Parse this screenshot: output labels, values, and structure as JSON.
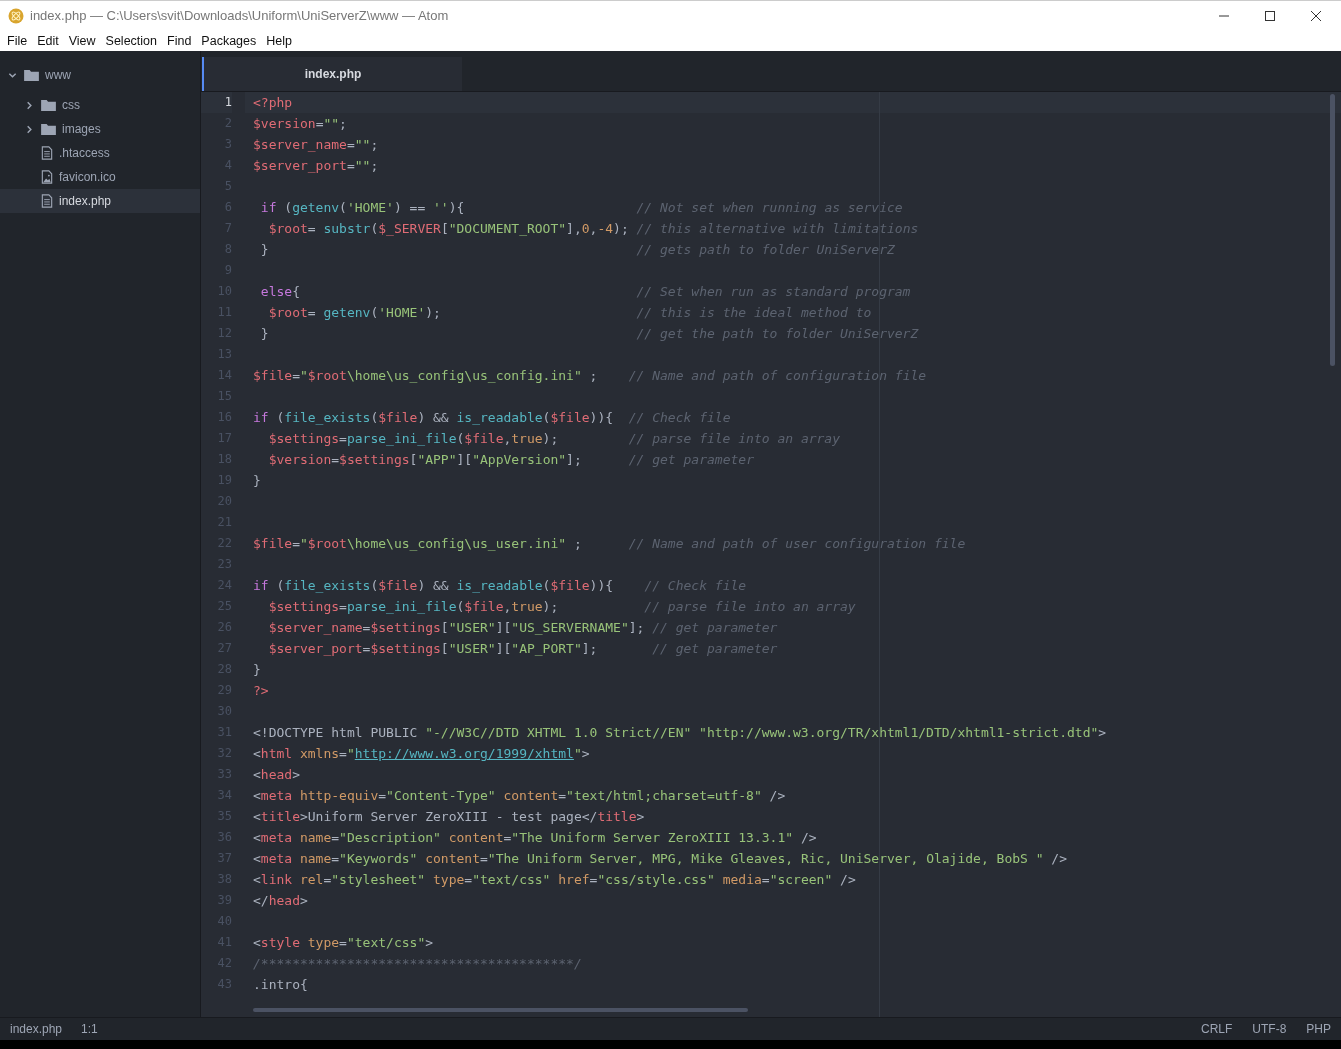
{
  "window": {
    "title": "index.php — C:\\Users\\svit\\Downloads\\Uniform\\UniServerZ\\www — Atom"
  },
  "menu": [
    "File",
    "Edit",
    "View",
    "Selection",
    "Find",
    "Packages",
    "Help"
  ],
  "tree": [
    {
      "label": "www",
      "kind": "folder",
      "expanded": true,
      "selected": false,
      "children": [
        {
          "label": "css",
          "kind": "folder",
          "expanded": false,
          "selected": false
        },
        {
          "label": "images",
          "kind": "folder",
          "expanded": false,
          "selected": false
        },
        {
          "label": ".htaccess",
          "kind": "file",
          "selected": false
        },
        {
          "label": "favicon.ico",
          "kind": "image",
          "selected": false
        },
        {
          "label": "index.php",
          "kind": "file",
          "selected": true
        }
      ]
    }
  ],
  "tabs": [
    {
      "label": "index.php",
      "selected": true
    }
  ],
  "lines": [
    {
      "number": "1",
      "current": true,
      "tokens": [
        {
          "kind": "tag",
          "text": "<?php"
        }
      ]
    },
    {
      "number": "2",
      "current": false,
      "tokens": [
        {
          "kind": "var",
          "text": "$version"
        },
        {
          "kind": "plain",
          "text": "="
        },
        {
          "kind": "str",
          "text": "\"\""
        },
        {
          "kind": "plain",
          "text": ";"
        }
      ]
    },
    {
      "number": "3",
      "current": false,
      "tokens": [
        {
          "kind": "var",
          "text": "$server_name"
        },
        {
          "kind": "plain",
          "text": "="
        },
        {
          "kind": "str",
          "text": "\"\""
        },
        {
          "kind": "plain",
          "text": ";"
        }
      ]
    },
    {
      "number": "4",
      "current": false,
      "tokens": [
        {
          "kind": "var",
          "text": "$server_port"
        },
        {
          "kind": "plain",
          "text": "="
        },
        {
          "kind": "str",
          "text": "\"\""
        },
        {
          "kind": "plain",
          "text": ";"
        }
      ]
    },
    {
      "number": "5",
      "current": false
    },
    {
      "number": "6",
      "current": false,
      "tokens": [
        {
          "kind": "kw",
          "text": " if"
        },
        {
          "kind": "plain",
          "text": " ("
        },
        {
          "kind": "fn",
          "text": "getenv"
        },
        {
          "kind": "plain",
          "text": "("
        },
        {
          "kind": "str",
          "text": "'HOME'"
        },
        {
          "kind": "plain",
          "text": ") == "
        },
        {
          "kind": "str",
          "text": "''"
        },
        {
          "kind": "plain",
          "text": "){                      "
        },
        {
          "kind": "cmt",
          "text": "// Not set when running as service"
        }
      ]
    },
    {
      "number": "7",
      "current": false,
      "tokens": [
        {
          "kind": "var",
          "text": "  $root"
        },
        {
          "kind": "plain",
          "text": "= "
        },
        {
          "kind": "fn",
          "text": "substr"
        },
        {
          "kind": "plain",
          "text": "("
        },
        {
          "kind": "var",
          "text": "$_SERVER"
        },
        {
          "kind": "plain",
          "text": "["
        },
        {
          "kind": "str",
          "text": "\"DOCUMENT_ROOT\""
        },
        {
          "kind": "plain",
          "text": "],"
        },
        {
          "kind": "num",
          "text": "0"
        },
        {
          "kind": "plain",
          "text": ","
        },
        {
          "kind": "num",
          "text": "-4"
        },
        {
          "kind": "plain",
          "text": "); "
        },
        {
          "kind": "cmt",
          "text": "// this alternative with limitations"
        }
      ]
    },
    {
      "number": "8",
      "current": false,
      "tokens": [
        {
          "kind": "plain",
          "text": " }                                               "
        },
        {
          "kind": "cmt",
          "text": "// gets path to folder UniServerZ"
        }
      ]
    },
    {
      "number": "9",
      "current": false
    },
    {
      "number": "10",
      "current": false,
      "tokens": [
        {
          "kind": "kw",
          "text": " else"
        },
        {
          "kind": "plain",
          "text": "{                                           "
        },
        {
          "kind": "cmt",
          "text": "// Set when run as standard program"
        }
      ]
    },
    {
      "number": "11",
      "current": false,
      "tokens": [
        {
          "kind": "var",
          "text": "  $root"
        },
        {
          "kind": "plain",
          "text": "= "
        },
        {
          "kind": "fn",
          "text": "getenv"
        },
        {
          "kind": "plain",
          "text": "("
        },
        {
          "kind": "str",
          "text": "'HOME'"
        },
        {
          "kind": "plain",
          "text": ");                         "
        },
        {
          "kind": "cmt",
          "text": "// this is the ideal method to"
        }
      ]
    },
    {
      "number": "12",
      "current": false,
      "tokens": [
        {
          "kind": "plain",
          "text": " }                                               "
        },
        {
          "kind": "cmt",
          "text": "// get the path to folder UniServerZ"
        }
      ]
    },
    {
      "number": "13",
      "current": false
    },
    {
      "number": "14",
      "current": false,
      "tokens": [
        {
          "kind": "var",
          "text": "$file"
        },
        {
          "kind": "plain",
          "text": "="
        },
        {
          "kind": "str",
          "text": "\""
        },
        {
          "kind": "var",
          "text": "$root"
        },
        {
          "kind": "str",
          "text": "\\home\\us_config\\us_config.ini\""
        },
        {
          "kind": "plain",
          "text": " ;    "
        },
        {
          "kind": "cmt",
          "text": "// Name and path of configuration file"
        }
      ]
    },
    {
      "number": "15",
      "current": false
    },
    {
      "number": "16",
      "current": false,
      "tokens": [
        {
          "kind": "kw",
          "text": "if"
        },
        {
          "kind": "plain",
          "text": " ("
        },
        {
          "kind": "fn",
          "text": "file_exists"
        },
        {
          "kind": "plain",
          "text": "("
        },
        {
          "kind": "var",
          "text": "$file"
        },
        {
          "kind": "plain",
          "text": ") && "
        },
        {
          "kind": "fn",
          "text": "is_readable"
        },
        {
          "kind": "plain",
          "text": "("
        },
        {
          "kind": "var",
          "text": "$file"
        },
        {
          "kind": "plain",
          "text": ")){  "
        },
        {
          "kind": "cmt",
          "text": "// Check file"
        }
      ]
    },
    {
      "number": "17",
      "current": false,
      "tokens": [
        {
          "kind": "var",
          "text": "  $settings"
        },
        {
          "kind": "plain",
          "text": "="
        },
        {
          "kind": "fn",
          "text": "parse_ini_file"
        },
        {
          "kind": "plain",
          "text": "("
        },
        {
          "kind": "var",
          "text": "$file"
        },
        {
          "kind": "plain",
          "text": ","
        },
        {
          "kind": "num",
          "text": "true"
        },
        {
          "kind": "plain",
          "text": ");         "
        },
        {
          "kind": "cmt",
          "text": "// parse file into an array"
        }
      ]
    },
    {
      "number": "18",
      "current": false,
      "tokens": [
        {
          "kind": "var",
          "text": "  $version"
        },
        {
          "kind": "plain",
          "text": "="
        },
        {
          "kind": "var",
          "text": "$settings"
        },
        {
          "kind": "plain",
          "text": "["
        },
        {
          "kind": "str",
          "text": "\"APP\""
        },
        {
          "kind": "plain",
          "text": "]["
        },
        {
          "kind": "str",
          "text": "\"AppVersion\""
        },
        {
          "kind": "plain",
          "text": "];      "
        },
        {
          "kind": "cmt",
          "text": "// get parameter"
        }
      ]
    },
    {
      "number": "19",
      "current": false,
      "tokens": [
        {
          "kind": "plain",
          "text": "}"
        }
      ]
    },
    {
      "number": "20",
      "current": false
    },
    {
      "number": "21",
      "current": false
    },
    {
      "number": "22",
      "current": false,
      "tokens": [
        {
          "kind": "var",
          "text": "$file"
        },
        {
          "kind": "plain",
          "text": "="
        },
        {
          "kind": "str",
          "text": "\""
        },
        {
          "kind": "var",
          "text": "$root"
        },
        {
          "kind": "str",
          "text": "\\home\\us_config\\us_user.ini\""
        },
        {
          "kind": "plain",
          "text": " ;      "
        },
        {
          "kind": "cmt",
          "text": "// Name and path of user configuration file"
        }
      ]
    },
    {
      "number": "23",
      "current": false
    },
    {
      "number": "24",
      "current": false,
      "tokens": [
        {
          "kind": "kw",
          "text": "if"
        },
        {
          "kind": "plain",
          "text": " ("
        },
        {
          "kind": "fn",
          "text": "file_exists"
        },
        {
          "kind": "plain",
          "text": "("
        },
        {
          "kind": "var",
          "text": "$file"
        },
        {
          "kind": "plain",
          "text": ") && "
        },
        {
          "kind": "fn",
          "text": "is_readable"
        },
        {
          "kind": "plain",
          "text": "("
        },
        {
          "kind": "var",
          "text": "$file"
        },
        {
          "kind": "plain",
          "text": ")){    "
        },
        {
          "kind": "cmt",
          "text": "// Check file"
        }
      ]
    },
    {
      "number": "25",
      "current": false,
      "tokens": [
        {
          "kind": "var",
          "text": "  $settings"
        },
        {
          "kind": "plain",
          "text": "="
        },
        {
          "kind": "fn",
          "text": "parse_ini_file"
        },
        {
          "kind": "plain",
          "text": "("
        },
        {
          "kind": "var",
          "text": "$file"
        },
        {
          "kind": "plain",
          "text": ","
        },
        {
          "kind": "num",
          "text": "true"
        },
        {
          "kind": "plain",
          "text": ");           "
        },
        {
          "kind": "cmt",
          "text": "// parse file into an array"
        }
      ]
    },
    {
      "number": "26",
      "current": false,
      "tokens": [
        {
          "kind": "var",
          "text": "  $server_name"
        },
        {
          "kind": "plain",
          "text": "="
        },
        {
          "kind": "var",
          "text": "$settings"
        },
        {
          "kind": "plain",
          "text": "["
        },
        {
          "kind": "str",
          "text": "\"USER\""
        },
        {
          "kind": "plain",
          "text": "]["
        },
        {
          "kind": "str",
          "text": "\"US_SERVERNAME\""
        },
        {
          "kind": "plain",
          "text": "]; "
        },
        {
          "kind": "cmt",
          "text": "// get parameter"
        }
      ]
    },
    {
      "number": "27",
      "current": false,
      "tokens": [
        {
          "kind": "var",
          "text": "  $server_port"
        },
        {
          "kind": "plain",
          "text": "="
        },
        {
          "kind": "var",
          "text": "$settings"
        },
        {
          "kind": "plain",
          "text": "["
        },
        {
          "kind": "str",
          "text": "\"USER\""
        },
        {
          "kind": "plain",
          "text": "]["
        },
        {
          "kind": "str",
          "text": "\"AP_PORT\""
        },
        {
          "kind": "plain",
          "text": "];       "
        },
        {
          "kind": "cmt",
          "text": "// get parameter"
        }
      ]
    },
    {
      "number": "28",
      "current": false,
      "tokens": [
        {
          "kind": "plain",
          "text": "}"
        }
      ]
    },
    {
      "number": "29",
      "current": false,
      "tokens": [
        {
          "kind": "tag",
          "text": "?>"
        }
      ]
    },
    {
      "number": "30",
      "current": false
    },
    {
      "number": "31",
      "current": false,
      "tokens": [
        {
          "kind": "plain",
          "text": "<!DOCTYPE html PUBLIC "
        },
        {
          "kind": "str",
          "text": "\"-//W3C//DTD XHTML 1.0 Strict//EN\" \"http://www.w3.org/TR/xhtml1/DTD/xhtml1-strict.dtd\""
        },
        {
          "kind": "plain",
          "text": ">"
        }
      ]
    },
    {
      "number": "32",
      "current": false,
      "tokens": [
        {
          "kind": "plain",
          "text": "<"
        },
        {
          "kind": "tag",
          "text": "html"
        },
        {
          "kind": "attr",
          "text": " xmlns"
        },
        {
          "kind": "plain",
          "text": "="
        },
        {
          "kind": "str",
          "text": "\""
        },
        {
          "kind": "link",
          "text": "http://www.w3.org/1999/xhtml"
        },
        {
          "kind": "str",
          "text": "\""
        },
        {
          "kind": "plain",
          "text": ">"
        }
      ]
    },
    {
      "number": "33",
      "current": false,
      "tokens": [
        {
          "kind": "plain",
          "text": "<"
        },
        {
          "kind": "tag",
          "text": "head"
        },
        {
          "kind": "plain",
          "text": ">"
        }
      ]
    },
    {
      "number": "34",
      "current": false,
      "tokens": [
        {
          "kind": "plain",
          "text": "<"
        },
        {
          "kind": "tag",
          "text": "meta"
        },
        {
          "kind": "attr",
          "text": " http-equiv"
        },
        {
          "kind": "plain",
          "text": "="
        },
        {
          "kind": "str",
          "text": "\"Content-Type\""
        },
        {
          "kind": "attr",
          "text": " content"
        },
        {
          "kind": "plain",
          "text": "="
        },
        {
          "kind": "str",
          "text": "\"text/html;charset=utf-8\""
        },
        {
          "kind": "plain",
          "text": " />"
        }
      ]
    },
    {
      "number": "35",
      "current": false,
      "tokens": [
        {
          "kind": "plain",
          "text": "<"
        },
        {
          "kind": "tag",
          "text": "title"
        },
        {
          "kind": "plain",
          "text": ">Uniform Server ZeroXIII - test page</"
        },
        {
          "kind": "tag",
          "text": "title"
        },
        {
          "kind": "plain",
          "text": ">"
        }
      ]
    },
    {
      "number": "36",
      "current": false,
      "tokens": [
        {
          "kind": "plain",
          "text": "<"
        },
        {
          "kind": "tag",
          "text": "meta"
        },
        {
          "kind": "attr",
          "text": " name"
        },
        {
          "kind": "plain",
          "text": "="
        },
        {
          "kind": "str",
          "text": "\"Description\""
        },
        {
          "kind": "attr",
          "text": " content"
        },
        {
          "kind": "plain",
          "text": "="
        },
        {
          "kind": "str",
          "text": "\"The Uniform Server ZeroXIII 13.3.1\""
        },
        {
          "kind": "plain",
          "text": " />"
        }
      ]
    },
    {
      "number": "37",
      "current": false,
      "tokens": [
        {
          "kind": "plain",
          "text": "<"
        },
        {
          "kind": "tag",
          "text": "meta"
        },
        {
          "kind": "attr",
          "text": " name"
        },
        {
          "kind": "plain",
          "text": "="
        },
        {
          "kind": "str",
          "text": "\"Keywords\""
        },
        {
          "kind": "attr",
          "text": " content"
        },
        {
          "kind": "plain",
          "text": "="
        },
        {
          "kind": "str",
          "text": "\"The Uniform Server, MPG, Mike Gleaves, Ric, UniServer, Olajide, BobS \""
        },
        {
          "kind": "plain",
          "text": " />"
        }
      ]
    },
    {
      "number": "38",
      "current": false,
      "tokens": [
        {
          "kind": "plain",
          "text": "<"
        },
        {
          "kind": "tag",
          "text": "link"
        },
        {
          "kind": "attr",
          "text": " rel"
        },
        {
          "kind": "plain",
          "text": "="
        },
        {
          "kind": "str",
          "text": "\"stylesheet\""
        },
        {
          "kind": "attr",
          "text": " type"
        },
        {
          "kind": "plain",
          "text": "="
        },
        {
          "kind": "str",
          "text": "\"text/css\""
        },
        {
          "kind": "attr",
          "text": " href"
        },
        {
          "kind": "plain",
          "text": "="
        },
        {
          "kind": "str",
          "text": "\"css/style.css\""
        },
        {
          "kind": "attr",
          "text": " media"
        },
        {
          "kind": "plain",
          "text": "="
        },
        {
          "kind": "str",
          "text": "\"screen\""
        },
        {
          "kind": "plain",
          "text": " />"
        }
      ]
    },
    {
      "number": "39",
      "current": false,
      "tokens": [
        {
          "kind": "plain",
          "text": "</"
        },
        {
          "kind": "tag",
          "text": "head"
        },
        {
          "kind": "plain",
          "text": ">"
        }
      ]
    },
    {
      "number": "40",
      "current": false
    },
    {
      "number": "41",
      "current": false,
      "tokens": [
        {
          "kind": "plain",
          "text": "<"
        },
        {
          "kind": "tag",
          "text": "style"
        },
        {
          "kind": "attr",
          "text": " type"
        },
        {
          "kind": "plain",
          "text": "="
        },
        {
          "kind": "str",
          "text": "\"text/css\""
        },
        {
          "kind": "plain",
          "text": ">"
        }
      ]
    },
    {
      "number": "42",
      "current": false,
      "tokens": [
        {
          "kind": "cmt",
          "text": "/****************************************/"
        }
      ]
    },
    {
      "number": "43",
      "current": false,
      "tokens": [
        {
          "kind": "plain",
          "text": ".intro{"
        }
      ]
    }
  ],
  "status_bar": {
    "left": [
      "index.php",
      "1:1"
    ],
    "right": [
      "CRLF",
      "UTF-8",
      "PHP"
    ]
  }
}
